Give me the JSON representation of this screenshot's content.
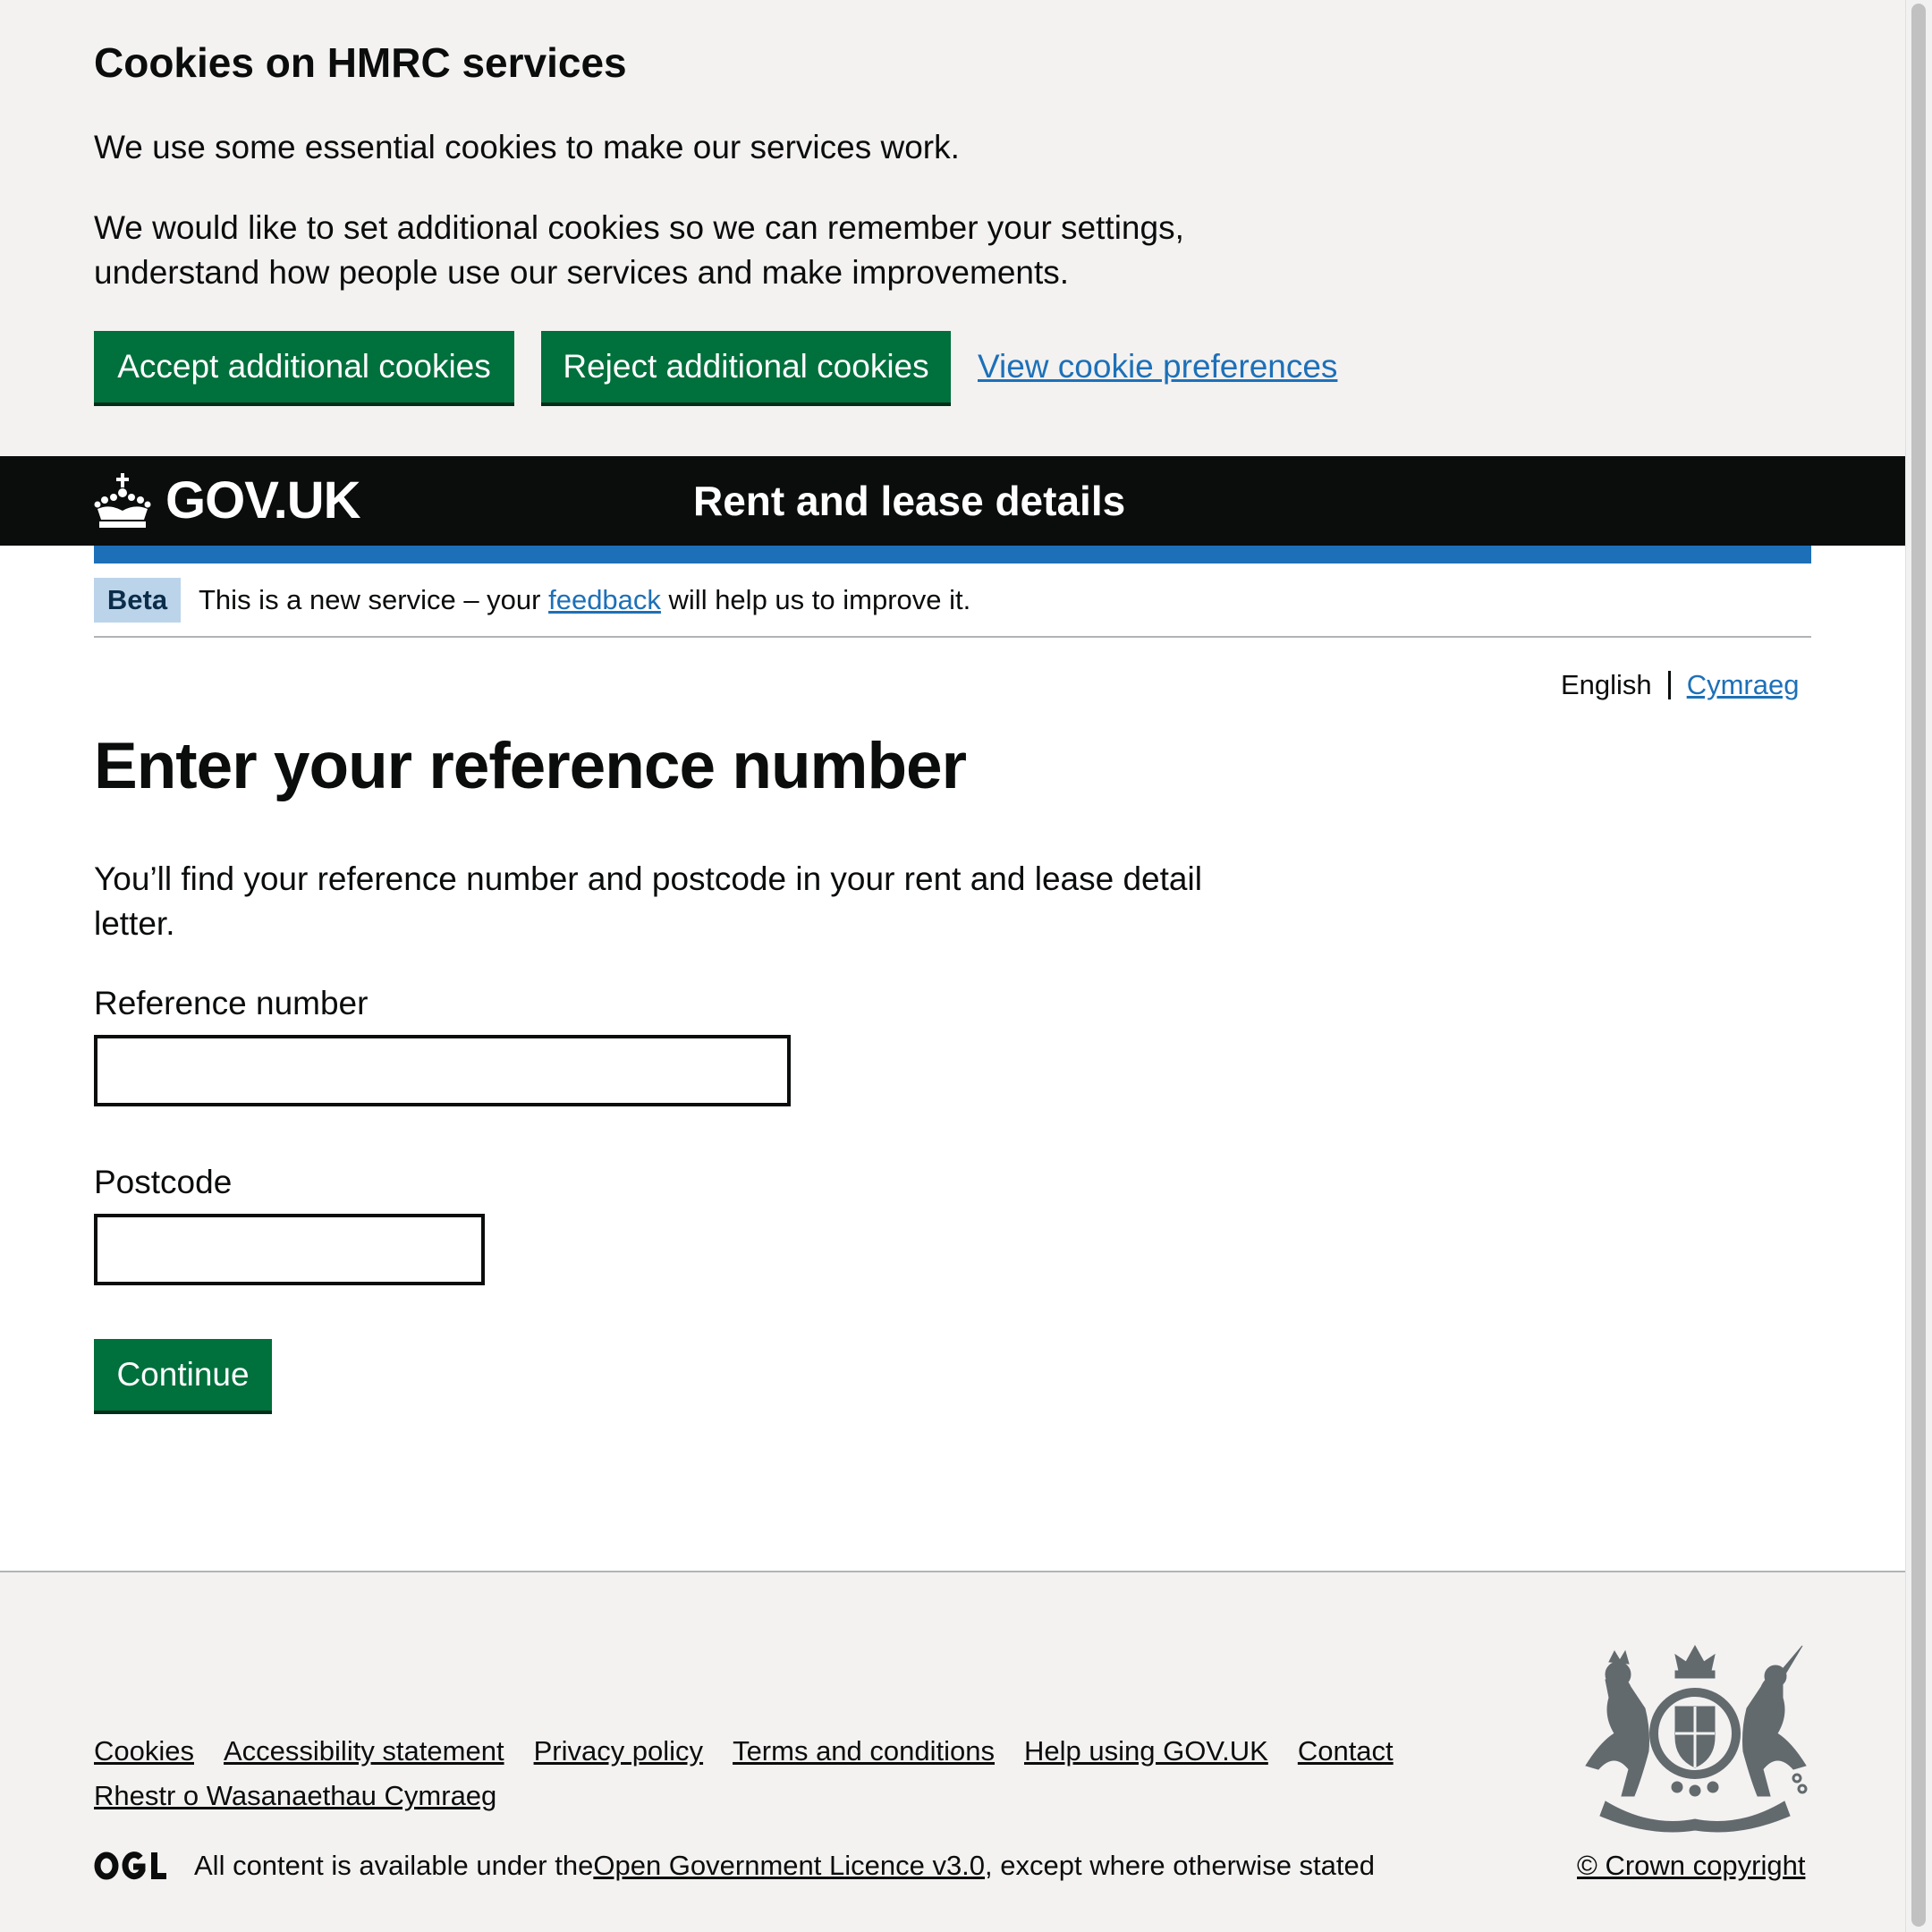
{
  "cookie_banner": {
    "title": "Cookies on HMRC services",
    "paragraph_1": "We use some essential cookies to make our services work.",
    "paragraph_2": "We would like to set additional cookies so we can remember your settings, understand how people use our services and make improvements.",
    "accept_label": "Accept additional cookies",
    "reject_label": "Reject additional cookies",
    "preferences_link": "View cookie preferences"
  },
  "header": {
    "logo_text": "GOV.UK",
    "service_name": "Rent and lease details",
    "logo_icon": "crown-icon"
  },
  "phase_banner": {
    "tag": "Beta",
    "text_before": "This is a new service – your ",
    "link_text": "feedback",
    "text_after": " will help us to improve it."
  },
  "language_toggle": {
    "current": "English",
    "other": "Cymraeg"
  },
  "main": {
    "heading": "Enter your reference number",
    "intro": "You’ll find your reference number and postcode in your rent and lease detail letter.",
    "reference_label": "Reference number",
    "reference_value": "",
    "postcode_label": "Postcode",
    "postcode_value": "",
    "continue_label": "Continue"
  },
  "footer": {
    "links": [
      "Cookies",
      "Accessibility statement",
      "Privacy policy",
      "Terms and conditions",
      "Help using GOV.UK",
      "Contact",
      "Rhestr o Wasanaethau Cymraeg"
    ],
    "licence_before": "All content is available under the ",
    "licence_link": "Open Government Licence v3.0",
    "licence_after": ", except where otherwise stated",
    "copyright": "© Crown copyright",
    "ogl_icon": "ogl-logo-icon",
    "crest_icon": "royal-coat-of-arms-icon"
  },
  "colors": {
    "brand_green": "#00703c",
    "link_blue": "#1d70b8",
    "header_black": "#0b0c0c",
    "banner_grey": "#f3f2f1",
    "beta_tag_bg": "#bbd4ea"
  }
}
